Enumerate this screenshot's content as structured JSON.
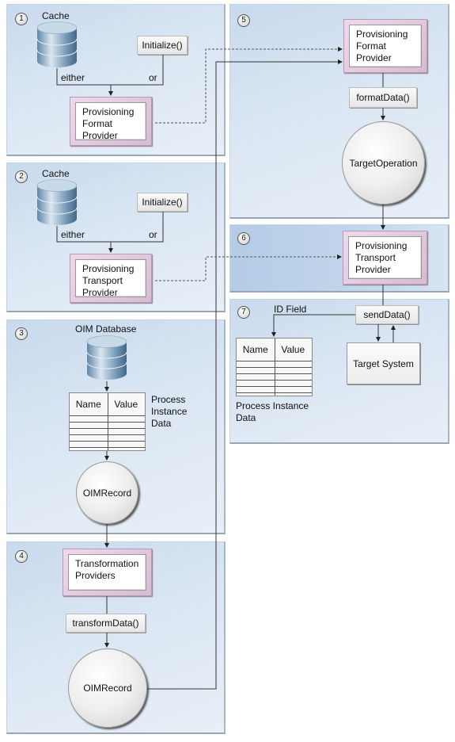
{
  "steps": [
    {
      "number": "1",
      "db_label": "Cache",
      "method": "Initialize()",
      "either": "either",
      "or": "or",
      "provider": "Provisioning Format Provider"
    },
    {
      "number": "2",
      "db_label": "Cache",
      "method": "Initialize()",
      "either": "either",
      "or": "or",
      "provider": "Provisioning Transport Provider"
    },
    {
      "number": "3",
      "db_label": "OIM Database",
      "table": {
        "columns": [
          "Name",
          "Value"
        ],
        "caption": "Process Instance Data"
      },
      "record": "OIMRecord"
    },
    {
      "number": "4",
      "provider": "Transformation Providers",
      "method": "transformData()",
      "record": "OIMRecord"
    },
    {
      "number": "5",
      "provider": "Provisioning Format Provider",
      "method": "formatData()",
      "operation": "TargetOperation"
    },
    {
      "number": "6",
      "provider": "Provisioning Transport Provider"
    },
    {
      "number": "7",
      "method": "sendData()",
      "id_field": "ID Field",
      "table": {
        "columns": [
          "Name",
          "Value"
        ],
        "caption": "Process Instance Data"
      },
      "target": "Target System"
    }
  ],
  "colors": {
    "panel": "#dde8f4",
    "panel_dark": "#c2d6ec",
    "provider_frame": "#e4cde1",
    "connector": "#333333"
  }
}
